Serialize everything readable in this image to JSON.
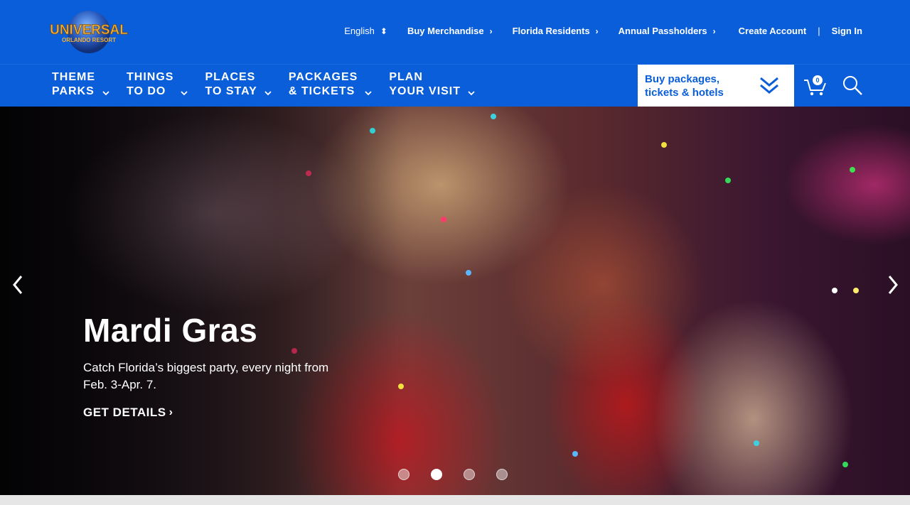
{
  "brand": {
    "logo_line1": "UNIVERSAL",
    "logo_line2": "ORLANDO RESORT"
  },
  "utility_nav": {
    "language": "English",
    "items": [
      "Buy Merchandise",
      "Florida Residents",
      "Annual Passholders"
    ],
    "create_account": "Create Account",
    "separator": "|",
    "sign_in": "Sign In"
  },
  "main_nav": {
    "items": [
      {
        "line1": "THEME",
        "line2": "PARKS"
      },
      {
        "line1": "THINGS",
        "line2": "TO DO"
      },
      {
        "line1": "PLACES",
        "line2": "TO STAY"
      },
      {
        "line1": "PACKAGES",
        "line2": "& TICKETS"
      },
      {
        "line1": "PLAN",
        "line2": "YOUR VISIT"
      }
    ],
    "buy_box": {
      "line1": "Buy packages,",
      "line2": "tickets & hotels"
    },
    "cart_count": "0"
  },
  "hero": {
    "title": "Mardi Gras",
    "subtitle": "Catch Florida’s biggest party, every night from Feb. 3-Apr. 7.",
    "cta": "GET DETAILS",
    "slide_count": 4,
    "active_slide": 2
  },
  "icons": {
    "chevron": "chevron-right-icon",
    "cart": "cart-icon",
    "search": "search-icon",
    "double_chevron": "double-chevron-down-icon"
  },
  "colors": {
    "brand_blue": "#0a5ed9",
    "white": "#ffffff"
  }
}
